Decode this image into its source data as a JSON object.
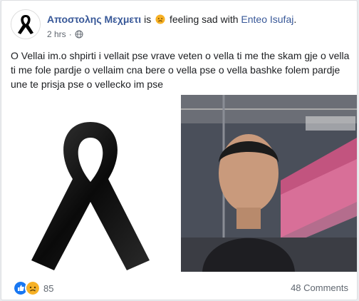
{
  "post": {
    "author": "Αποστολης Μεχμετι",
    "is_text": "is",
    "feeling_text": "feeling sad with",
    "tagged": "Enteo Isufaj",
    "period": ".",
    "time": "2 hrs",
    "time_sep": "·",
    "privacy_icon": "globe-icon",
    "body": "O Vellai im.o shpirti i vellait pse vrave veten o vella ti me the skam gje o vella ti me fole pardje o vellaim cna bere o vella pse o vella bashke folem pardje une te prisja pse o vellecko im pse"
  },
  "footer": {
    "reaction_icons": [
      "like-icon",
      "sad-icon"
    ],
    "reaction_count": "85",
    "comments": "48 Comments"
  },
  "colors": {
    "link": "#385898",
    "text": "#1c1e21",
    "meta": "#606770",
    "like_blue": "#1877f2",
    "sad_yellow": "#f7b125"
  }
}
